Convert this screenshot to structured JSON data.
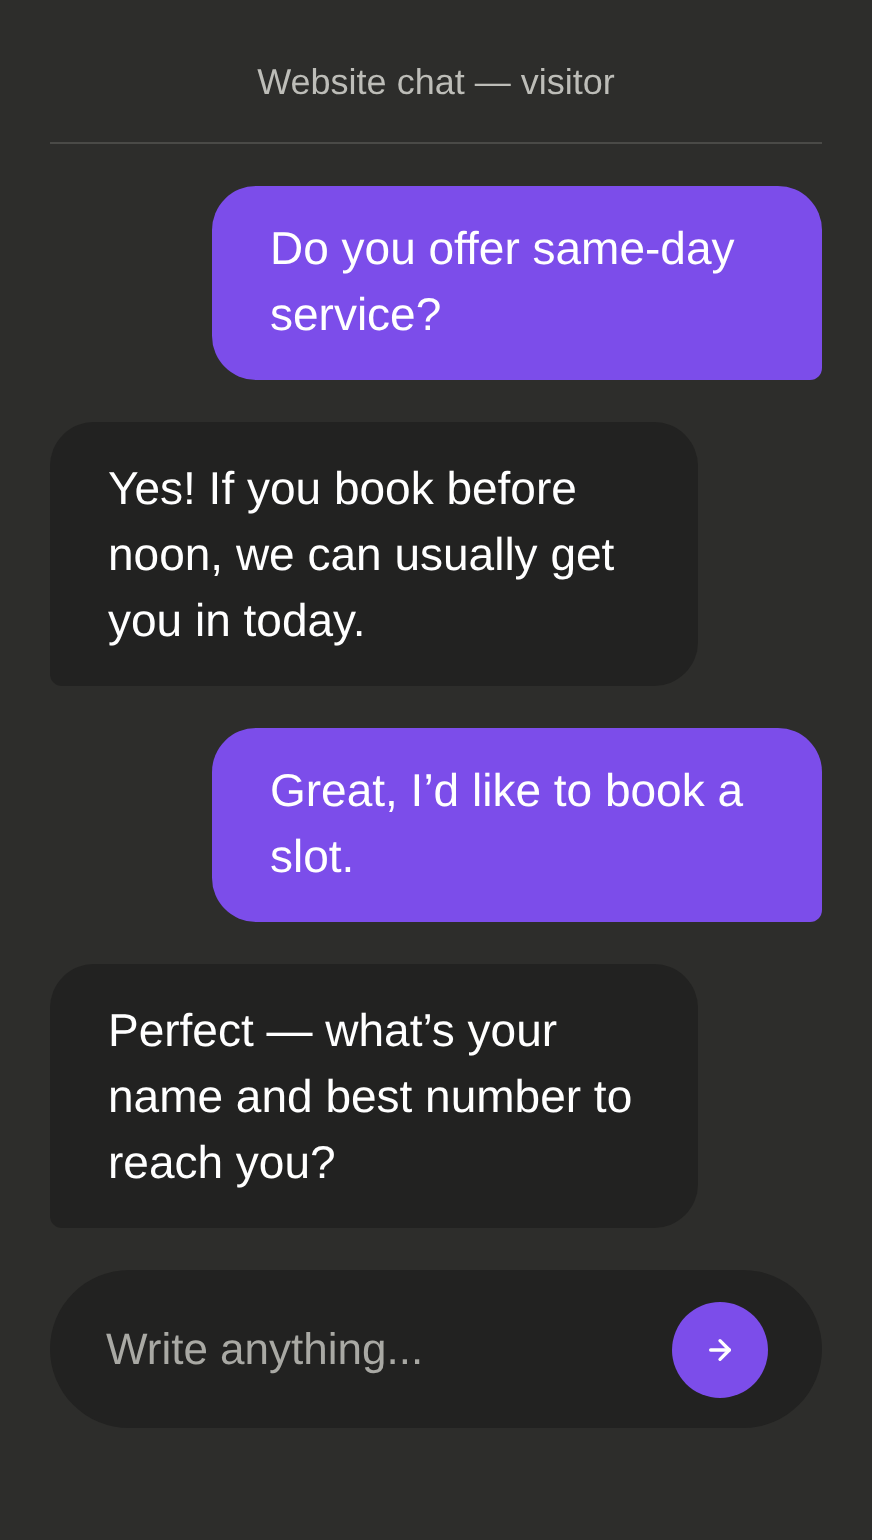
{
  "header": {
    "title": "Website chat — visitor"
  },
  "messages": [
    {
      "kind": "sent",
      "text": "Do you offer same-day service?"
    },
    {
      "kind": "received",
      "text": "Yes! If you book before noon, we can usually get you in today."
    },
    {
      "kind": "sent",
      "text": "Great, I’d like to book a slot."
    },
    {
      "kind": "received",
      "text": "Perfect — what’s your name and best number to reach you?"
    }
  ],
  "composer": {
    "placeholder": "Write anything..."
  }
}
